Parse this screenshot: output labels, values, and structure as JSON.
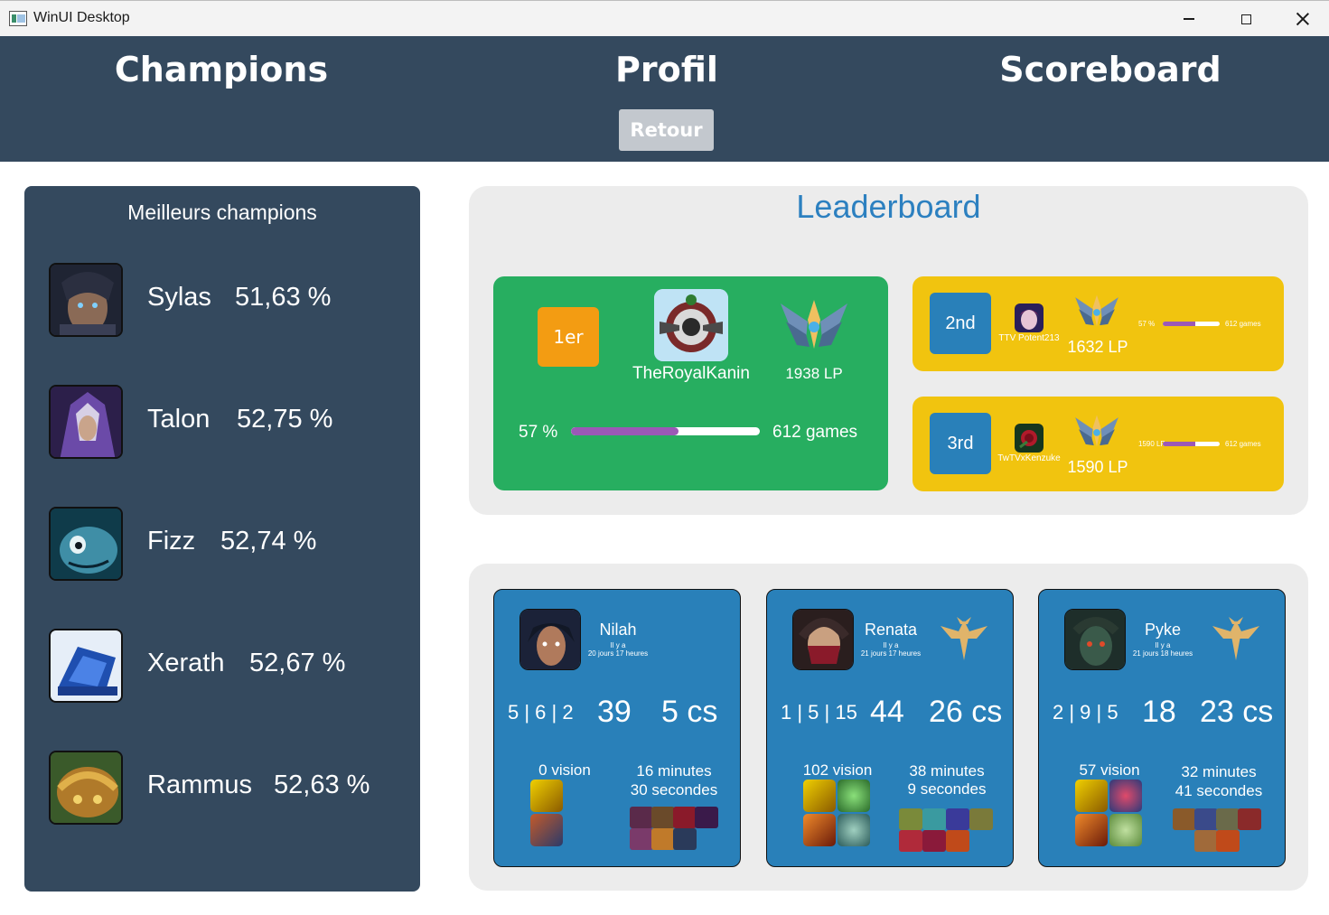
{
  "window": {
    "title": "WinUI Desktop"
  },
  "nav": {
    "champions": "Champions",
    "profil": "Profil",
    "scoreboard": "Scoreboard",
    "back": "Retour"
  },
  "best_champions": {
    "title": "Meilleurs champions",
    "items": [
      {
        "name": "Sylas",
        "rate": "51,63 %"
      },
      {
        "name": "Talon",
        "rate": "52,75 %"
      },
      {
        "name": "Fizz",
        "rate": "52,74 %"
      },
      {
        "name": "Xerath",
        "rate": "52,67 %"
      },
      {
        "name": "Rammus",
        "rate": "52,63 %"
      }
    ]
  },
  "leaderboard": {
    "title": "Leaderboard",
    "first": {
      "rank": "1er",
      "name": "TheRoyalKanin",
      "lp": "1938 LP",
      "winrate": "57 %",
      "winrate_value": 0.57,
      "games": "612 games"
    },
    "second": {
      "rank": "2nd",
      "name": "TTV Potent213",
      "lp": "1632 LP",
      "winrate": "57 %",
      "winrate_value": 0.57,
      "games": "612 games"
    },
    "third": {
      "rank": "3rd",
      "name": "TwTVxKenzuke",
      "lp": "1590 LP",
      "winrate": "1590 LP",
      "winrate_value": 0.57,
      "games": "612 games"
    }
  },
  "matches": [
    {
      "champion": "Nilah",
      "ago_prefix": "Il y a",
      "ago": "20 jours 17 heures",
      "kda": "5 | 6 | 2",
      "score": "39",
      "cs": "5 cs",
      "vision": "0 vision",
      "duration_min": "16 minutes",
      "duration_sec": "30 secondes",
      "role_icon": "none"
    },
    {
      "champion": "Renata",
      "ago_prefix": "Il y a",
      "ago": "21 jours 17 heures",
      "kda": "1 | 5 | 15",
      "score": "44",
      "cs": "26 cs",
      "vision": "102 vision",
      "duration_min": "38 minutes",
      "duration_sec": "9 secondes",
      "role_icon": "support-role-icon"
    },
    {
      "champion": "Pyke",
      "ago_prefix": "Il y a",
      "ago": "21 jours 18 heures",
      "kda": "2 | 9 | 5",
      "score": "18",
      "cs": "23 cs",
      "vision": "57 vision",
      "duration_min": "32 minutes",
      "duration_sec": "41 secondes",
      "role_icon": "support-role-icon"
    }
  ],
  "colors": {
    "nav_bg": "#34495e",
    "first_card": "#27ae60",
    "other_cards": "#f1c40f",
    "rank_first": "#f39c12",
    "rank_other": "#2980b9",
    "match_card": "#2980b9",
    "winrate_fill": "#9b59b6",
    "leader_title": "#2c80c0"
  }
}
